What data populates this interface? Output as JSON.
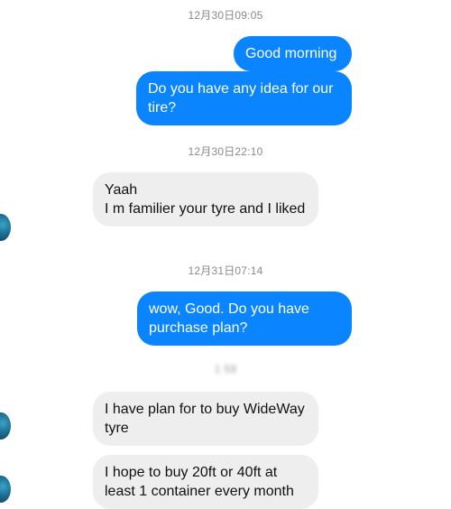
{
  "messages": [
    {
      "type": "timestamp",
      "text": "12月30日09:05"
    },
    {
      "type": "outgoing",
      "text": "Good morning"
    },
    {
      "type": "outgoing",
      "text": "Do you have any idea for our tire?"
    },
    {
      "type": "timestamp",
      "text": "12月30日22:10"
    },
    {
      "type": "incoming",
      "text": "Yaah\nI m familier your tyre and  I liked"
    },
    {
      "type": "timestamp",
      "text": "12月31日07:14"
    },
    {
      "type": "outgoing",
      "text": "wow, Good. Do you have purchase plan?"
    },
    {
      "type": "timestamp",
      "text": "1 59"
    },
    {
      "type": "incoming",
      "text": "I have plan for to buy WideWay tyre"
    },
    {
      "type": "incoming",
      "text": "I  hope to buy 20ft  or 40ft at least 1  container every month"
    }
  ],
  "colors": {
    "outgoing_bubble": "#0a84ff",
    "incoming_bubble": "#eeeeee",
    "timestamp_text": "#8a8a8a"
  }
}
